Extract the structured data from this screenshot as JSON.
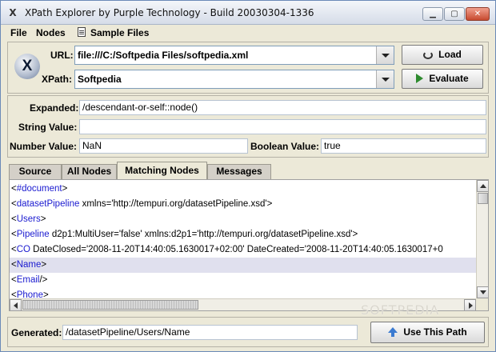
{
  "window": {
    "title": "XPath Explorer by Purple Technology - Build 20030304-1336",
    "controls": {
      "minimize": "▁",
      "maximize": "▢",
      "close": "✕"
    }
  },
  "menu": {
    "file": "File",
    "nodes": "Nodes",
    "sample_files": "Sample Files"
  },
  "logo": "X",
  "url": {
    "label": "URL:",
    "value": "file:///C:/Softpedia Files/softpedia.xml",
    "button": "Load"
  },
  "xpath": {
    "label": "XPath:",
    "value": "Softpedia",
    "button": "Evaluate"
  },
  "info": {
    "expanded_label": "Expanded:",
    "expanded_value": "/descendant-or-self::node()",
    "string_label": "String Value:",
    "string_value": "",
    "number_label": "Number Value:",
    "number_value": "NaN",
    "boolean_label": "Boolean Value:",
    "boolean_value": "true"
  },
  "tabs": [
    {
      "label": "Source",
      "active": false
    },
    {
      "label": "All Nodes",
      "active": false
    },
    {
      "label": "Matching Nodes",
      "active": true
    },
    {
      "label": "Messages",
      "active": false
    }
  ],
  "xml_lines": [
    {
      "pre": "<",
      "tag": "#document",
      "rest": ">"
    },
    {
      "pre": "<",
      "tag": "datasetPipeline",
      "rest": " xmlns='http://tempuri.org/datasetPipeline.xsd'>"
    },
    {
      "pre": "<",
      "tag": "Users",
      "rest": ">"
    },
    {
      "pre": "<",
      "tag": "Pipeline",
      "rest": " d2p1:MultiUser='false' xmlns:d2p1='http://tempuri.org/datasetPipeline.xsd'>"
    },
    {
      "pre": "<",
      "tag": "CO",
      "rest": " DateClosed='2008-11-20T14:40:05.1630017+02:00' DateCreated='2008-11-20T14:40:05.1630017+0"
    },
    {
      "pre": "<",
      "tag": "Name",
      "rest": ">",
      "selected": true
    },
    {
      "pre": "<",
      "tag": "Email",
      "rest": "/>"
    },
    {
      "pre": "<",
      "tag": "Phone",
      "rest": ">"
    }
  ],
  "footer": {
    "generated_label": "Generated:",
    "generated_value": "/datasetPipeline/Users/Name",
    "button": "Use This Path"
  },
  "watermark": "SOFTPEDIA"
}
